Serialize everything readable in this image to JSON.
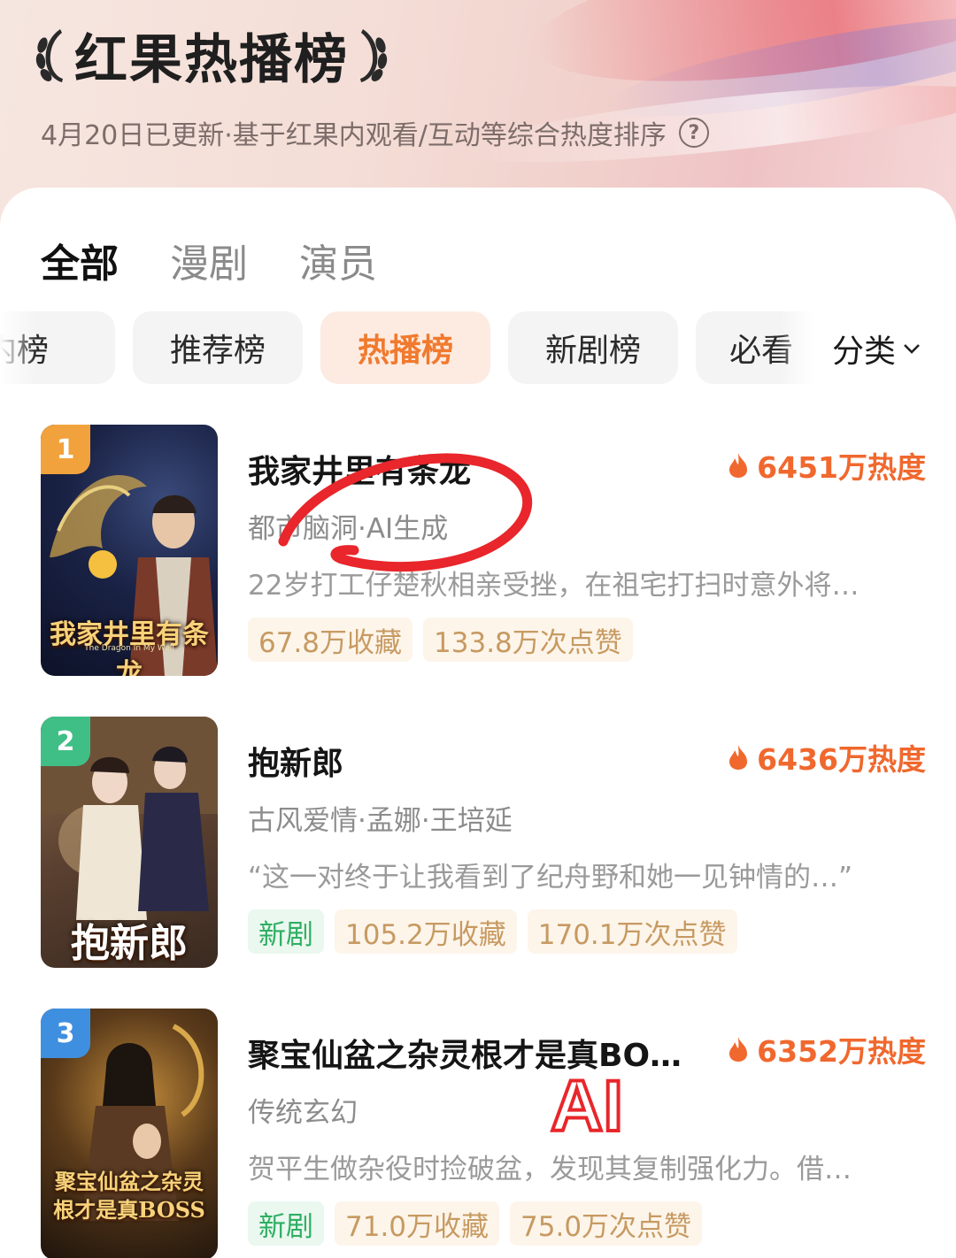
{
  "header": {
    "title": "红果热播榜",
    "subtitle": "4月20日已更新·基于红果内观看/互动等综合热度排序",
    "help_icon": "question-circle-icon"
  },
  "main_tabs": [
    {
      "label": "全部",
      "active": true
    },
    {
      "label": "漫剧",
      "active": false
    },
    {
      "label": "演员",
      "active": false
    }
  ],
  "pill_tabs": [
    {
      "label": "内榜",
      "active": false
    },
    {
      "label": "推荐榜",
      "active": false
    },
    {
      "label": "热播榜",
      "active": true
    },
    {
      "label": "新剧榜",
      "active": false
    },
    {
      "label": "必看",
      "active": false
    }
  ],
  "category": {
    "label": "分类",
    "icon": "chevron-down-icon"
  },
  "colors": {
    "accent": "#f07a2e",
    "heat": "#f0682e",
    "rank1": "#f2a23c",
    "rank2": "#3fbf86",
    "rank3": "#3f8fe0",
    "new_badge": "#2fae63",
    "annotation": "#e8262b"
  },
  "items": [
    {
      "rank": "1",
      "title": "我家井里有条龙",
      "heat": "6451万热度",
      "tags": "都市脑洞·AI生成",
      "desc": "22岁打工仔楚秋相亲受挫，在祖宅打扫时意外将…",
      "badges": [
        "67.8万收藏",
        "133.8万次点赞"
      ],
      "poster_title": "我家井里有条龙",
      "poster_subtitle": "The Dragon In My Well"
    },
    {
      "rank": "2",
      "title": "抱新郎",
      "heat": "6436万热度",
      "tags": "古风爱情·孟娜·王培延",
      "desc": "“这一对终于让我看到了纪舟野和她一见钟情的…”",
      "badges": [
        "新剧",
        "105.2万收藏",
        "170.1万次点赞"
      ],
      "poster_title": "抱新郎"
    },
    {
      "rank": "3",
      "title": "聚宝仙盆之杂灵根才是真BO…",
      "heat": "6352万热度",
      "tags": "传统玄幻",
      "desc": "贺平生做杂役时捡破盆，发现其复制强化力。借…",
      "badges": [
        "新剧",
        "71.0万收藏",
        "75.0万次点赞"
      ],
      "poster_title": "聚宝仙盆之杂灵根才是真BOSS"
    }
  ],
  "annotation_text": "AI"
}
